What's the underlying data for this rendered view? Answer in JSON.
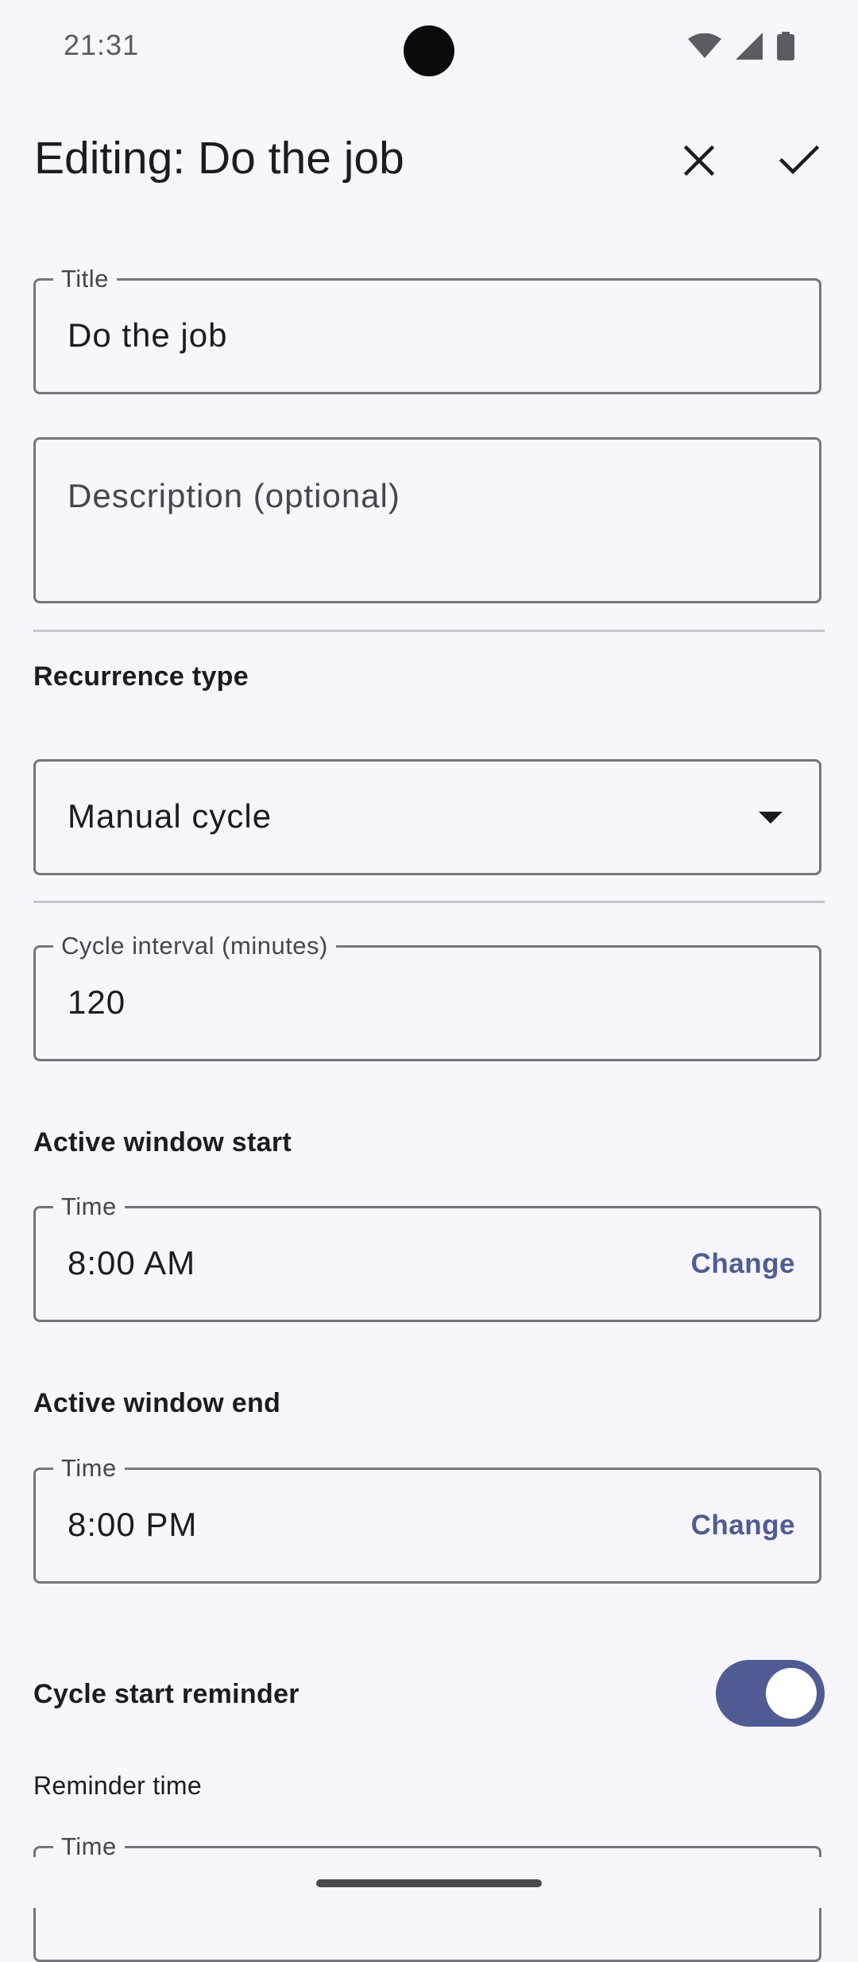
{
  "status_bar": {
    "time": "21:31",
    "icons": [
      "wifi-icon",
      "cell-signal-icon",
      "battery-icon"
    ]
  },
  "app_bar": {
    "title": "Editing: Do the job",
    "close_icon": "close-icon",
    "save_icon": "check-icon"
  },
  "form": {
    "title_field": {
      "label": "Title",
      "value": "Do the job"
    },
    "description_field": {
      "placeholder": "Description (optional)",
      "value": ""
    },
    "recurrence": {
      "section_label": "Recurrence type",
      "selected": "Manual cycle"
    },
    "cycle_interval": {
      "label": "Cycle interval (minutes)",
      "value": "120"
    },
    "window_start": {
      "section_label": "Active window start",
      "field_label": "Time",
      "value": "8:00 AM",
      "action": "Change"
    },
    "window_end": {
      "section_label": "Active window end",
      "field_label": "Time",
      "value": "8:00 PM",
      "action": "Change"
    },
    "reminder": {
      "label": "Cycle start reminder",
      "enabled": true,
      "time_label": "Reminder time",
      "field_label": "Time"
    }
  },
  "colors": {
    "background": "#f7f6fc",
    "accent": "#4f5b92",
    "outline": "#75757f"
  }
}
